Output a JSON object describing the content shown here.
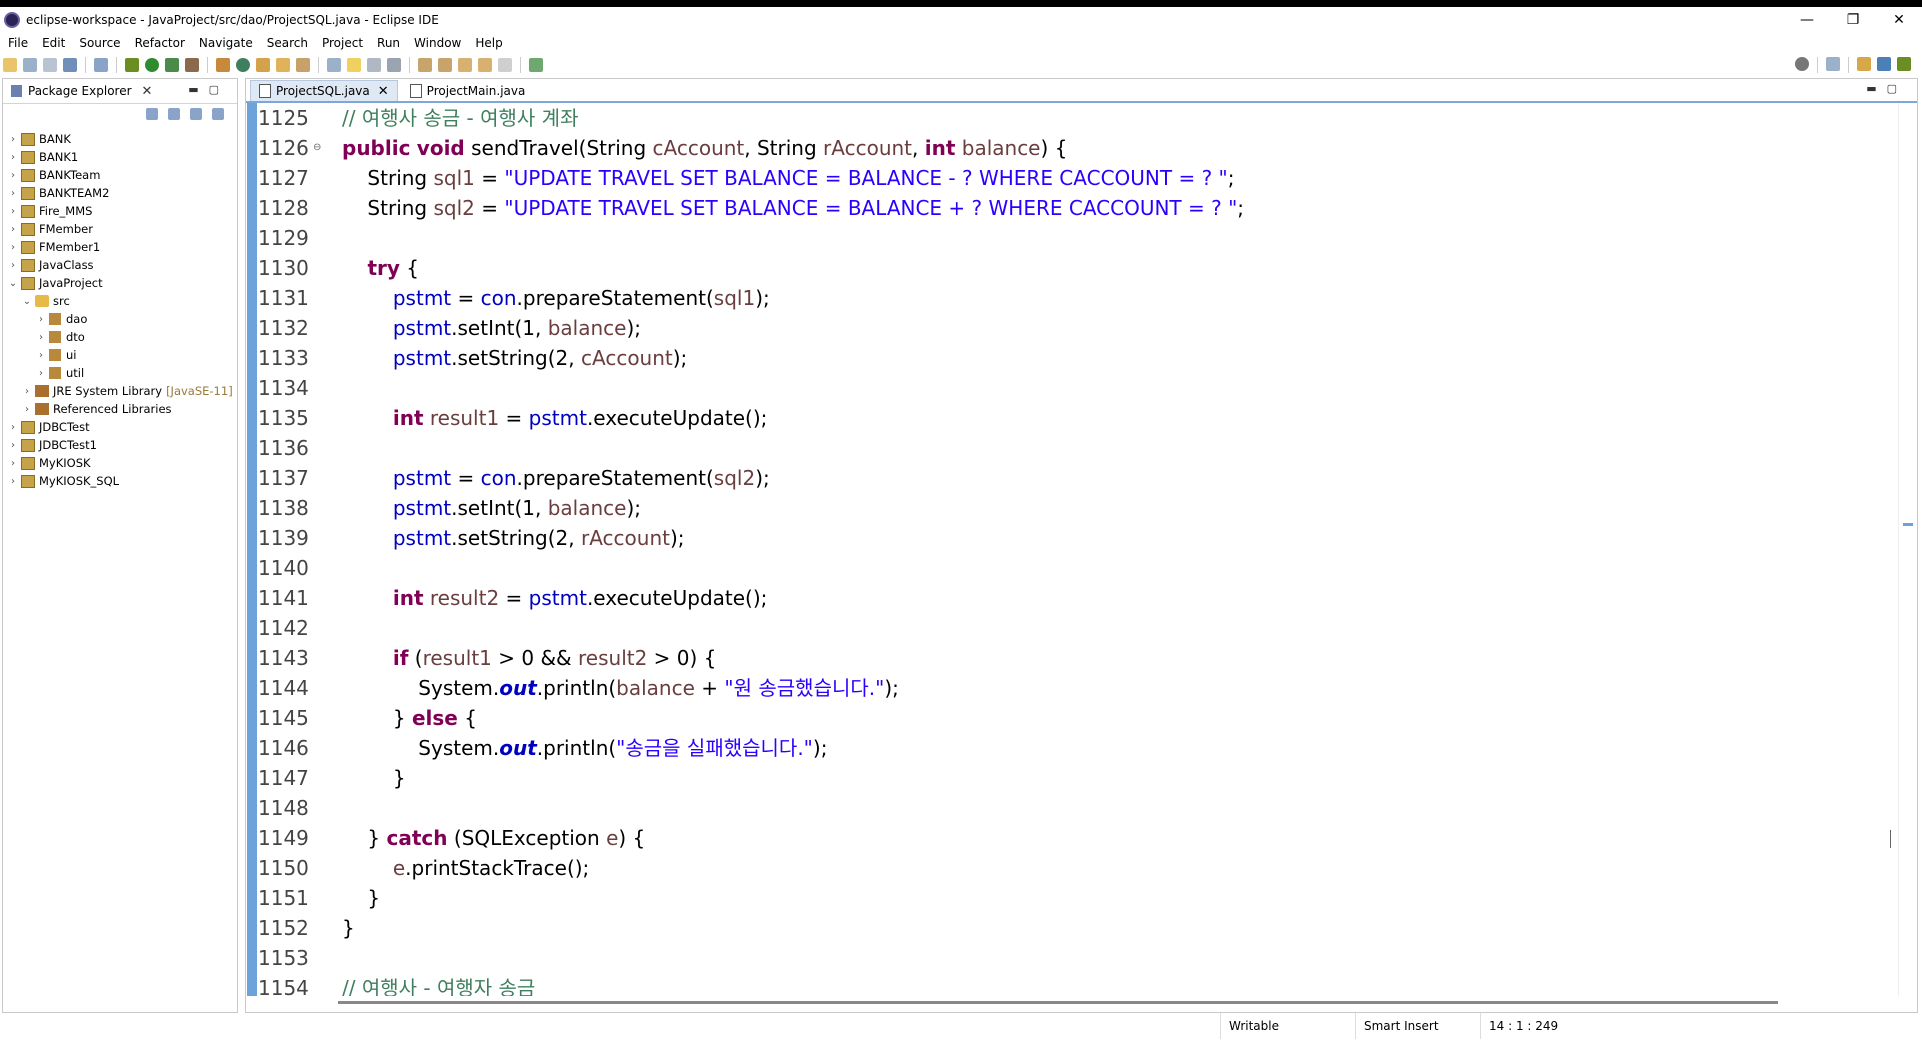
{
  "window": {
    "title": "eclipse-workspace - JavaProject/src/dao/ProjectSQL.java - Eclipse IDE",
    "minimize": "—",
    "maximize": "❐",
    "close": "✕"
  },
  "menu": [
    "File",
    "Edit",
    "Source",
    "Refactor",
    "Navigate",
    "Search",
    "Project",
    "Run",
    "Window",
    "Help"
  ],
  "package_explorer": {
    "tab_label": "Package Explorer",
    "close_glyph": "✕",
    "items": [
      {
        "label": "BANK",
        "arrow": "›",
        "kind": "project"
      },
      {
        "label": "BANK1",
        "arrow": "›",
        "kind": "project"
      },
      {
        "label": "BANKTeam",
        "arrow": "›",
        "kind": "project"
      },
      {
        "label": "BANKTEAM2",
        "arrow": "›",
        "kind": "project"
      },
      {
        "label": "Fire_MMS",
        "arrow": "›",
        "kind": "project"
      },
      {
        "label": "FMember",
        "arrow": "›",
        "kind": "project"
      },
      {
        "label": "FMember1",
        "arrow": "›",
        "kind": "project"
      },
      {
        "label": "JavaClass",
        "arrow": "›",
        "kind": "project"
      },
      {
        "label": "JavaProject",
        "arrow": "⌄",
        "kind": "project"
      },
      {
        "label": "src",
        "arrow": "⌄",
        "kind": "folder",
        "indent": 1
      },
      {
        "label": "dao",
        "arrow": "›",
        "kind": "package",
        "indent": 2
      },
      {
        "label": "dto",
        "arrow": "›",
        "kind": "package",
        "indent": 2
      },
      {
        "label": "ui",
        "arrow": "›",
        "kind": "package",
        "indent": 2
      },
      {
        "label": "util",
        "arrow": "›",
        "kind": "package",
        "indent": 2
      },
      {
        "label": "JRE System Library",
        "tag": "[JavaSE-11]",
        "arrow": "›",
        "kind": "library",
        "indent": 1
      },
      {
        "label": "Referenced Libraries",
        "arrow": "›",
        "kind": "library",
        "indent": 1
      },
      {
        "label": "JDBCTest",
        "arrow": "›",
        "kind": "project"
      },
      {
        "label": "JDBCTest1",
        "arrow": "›",
        "kind": "project"
      },
      {
        "label": "MyKIOSK",
        "arrow": "›",
        "kind": "project"
      },
      {
        "label": "MyKIOSK_SQL",
        "arrow": "›",
        "kind": "project"
      }
    ]
  },
  "editor": {
    "tabs": [
      {
        "label": "ProjectSQL.java",
        "active": true,
        "close": "✕"
      },
      {
        "label": "ProjectMain.java",
        "active": false
      }
    ],
    "lines": [
      {
        "n": "1125",
        "html": "<span class=\"cm\">// 여행사 송금 - 여행사 계좌</span>"
      },
      {
        "n": "1126",
        "fold": "⊖",
        "html": "<span class=\"kw\">public</span> <span class=\"kw\">void</span> sendTravel(String <span class=\"var\">cAccount</span>, String <span class=\"var\">rAccount</span>, <span class=\"kw\">int</span> <span class=\"var\">balance</span>) {"
      },
      {
        "n": "1127",
        "html": "    String <span class=\"var\">sql1</span> = <span class=\"str\">\"UPDATE TRAVEL SET BALANCE = BALANCE - ? WHERE CACCOUNT = ? \"</span>;"
      },
      {
        "n": "1128",
        "html": "    String <span class=\"var\">sql2</span> = <span class=\"str\">\"UPDATE TRAVEL SET BALANCE = BALANCE + ? WHERE CACCOUNT = ? \"</span>;"
      },
      {
        "n": "1129",
        "html": ""
      },
      {
        "n": "1130",
        "html": "    <span class=\"kw\">try</span> {"
      },
      {
        "n": "1131",
        "html": "        <span class=\"fld\">pstmt</span> = <span class=\"fld\">con</span>.prepareStatement(<span class=\"var\">sql1</span>);"
      },
      {
        "n": "1132",
        "html": "        <span class=\"fld\">pstmt</span>.setInt(1, <span class=\"var\">balance</span>);"
      },
      {
        "n": "1133",
        "html": "        <span class=\"fld\">pstmt</span>.setString(2, <span class=\"var\">cAccount</span>);"
      },
      {
        "n": "1134",
        "html": ""
      },
      {
        "n": "1135",
        "html": "        <span class=\"kw\">int</span> <span class=\"var\">result1</span> = <span class=\"fld\">pstmt</span>.executeUpdate();"
      },
      {
        "n": "1136",
        "html": ""
      },
      {
        "n": "1137",
        "html": "        <span class=\"fld\">pstmt</span> = <span class=\"fld\">con</span>.prepareStatement(<span class=\"var\">sql2</span>);"
      },
      {
        "n": "1138",
        "html": "        <span class=\"fld\">pstmt</span>.setInt(1, <span class=\"var\">balance</span>);"
      },
      {
        "n": "1139",
        "html": "        <span class=\"fld\">pstmt</span>.setString(2, <span class=\"var\">rAccount</span>);"
      },
      {
        "n": "1140",
        "html": ""
      },
      {
        "n": "1141",
        "html": "        <span class=\"kw\">int</span> <span class=\"var\">result2</span> = <span class=\"fld\">pstmt</span>.executeUpdate();"
      },
      {
        "n": "1142",
        "html": ""
      },
      {
        "n": "1143",
        "html": "        <span class=\"kw\">if</span> (<span class=\"var\">result1</span> &gt; 0 &amp;&amp; <span class=\"var\">result2</span> &gt; 0) {"
      },
      {
        "n": "1144",
        "html": "            System.<span class=\"sfld\">out</span>.println(<span class=\"var\">balance</span> + <span class=\"str\">\"원 송금했습니다.\"</span>);"
      },
      {
        "n": "1145",
        "html": "        } <span class=\"kw\">else</span> {"
      },
      {
        "n": "1146",
        "html": "            System.<span class=\"sfld\">out</span>.println(<span class=\"str\">\"송금을 실패했습니다.\"</span>);"
      },
      {
        "n": "1147",
        "html": "        }"
      },
      {
        "n": "1148",
        "html": ""
      },
      {
        "n": "1149",
        "html": "    } <span class=\"kw\">catch</span> (SQLException <span class=\"var\">e</span>) {"
      },
      {
        "n": "1150",
        "html": "        <span class=\"var\">e</span>.printStackTrace();"
      },
      {
        "n": "1151",
        "html": "    }"
      },
      {
        "n": "1152",
        "html": "}"
      },
      {
        "n": "1153",
        "html": ""
      },
      {
        "n": "1154",
        "html": "<span class=\"cm\">// 여행사 - 여행자 송금</span>"
      }
    ]
  },
  "status": {
    "writable": "Writable",
    "insert_mode": "Smart Insert",
    "position": "14 : 1 : 249"
  }
}
